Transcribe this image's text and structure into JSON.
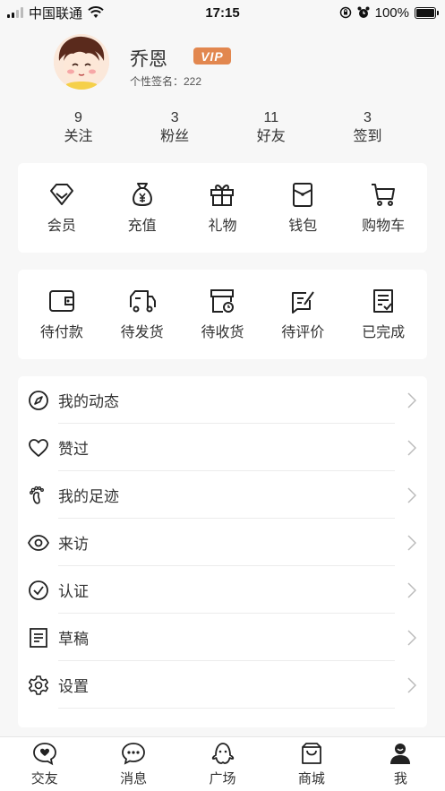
{
  "status_bar": {
    "carrier": "中国联通",
    "time": "17:15",
    "battery": "100%"
  },
  "profile": {
    "name": "乔恩",
    "badge": "VIP",
    "signature": "个性签名：222"
  },
  "stats": [
    {
      "value": "9",
      "label": "关注"
    },
    {
      "value": "3",
      "label": "粉丝"
    },
    {
      "value": "11",
      "label": "好友"
    },
    {
      "value": "3",
      "label": "签到"
    }
  ],
  "services": [
    {
      "label": "会员",
      "icon": "diamond-icon"
    },
    {
      "label": "充值",
      "icon": "money-bag-icon"
    },
    {
      "label": "礼物",
      "icon": "gift-icon"
    },
    {
      "label": "钱包",
      "icon": "wallet-icon"
    },
    {
      "label": "购物车",
      "icon": "cart-icon"
    }
  ],
  "orders": [
    {
      "label": "待付款",
      "icon": "wallet-icon"
    },
    {
      "label": "待发货",
      "icon": "truck-icon"
    },
    {
      "label": "待收货",
      "icon": "box-clock-icon"
    },
    {
      "label": "待评价",
      "icon": "review-icon"
    },
    {
      "label": "已完成",
      "icon": "document-check-icon"
    }
  ],
  "menu": [
    {
      "label": "我的动态",
      "icon": "compass-icon"
    },
    {
      "label": "赞过",
      "icon": "heart-icon"
    },
    {
      "label": "我的足迹",
      "icon": "footprint-icon"
    },
    {
      "label": "来访",
      "icon": "eye-icon"
    },
    {
      "label": "认证",
      "icon": "check-circle-icon"
    },
    {
      "label": "草稿",
      "icon": "document-icon"
    },
    {
      "label": "设置",
      "icon": "gear-icon"
    }
  ],
  "tabs": [
    {
      "label": "交友",
      "icon": "heart-chat-icon"
    },
    {
      "label": "消息",
      "icon": "chat-bubble-icon"
    },
    {
      "label": "广场",
      "icon": "ghost-icon"
    },
    {
      "label": "商城",
      "icon": "shopping-bag-icon"
    },
    {
      "label": "我",
      "icon": "user-icon",
      "active": true
    }
  ],
  "colors": {
    "vip_badge": "#e2874f",
    "background": "#f7f7f7",
    "card": "#ffffff",
    "text": "#333333"
  }
}
